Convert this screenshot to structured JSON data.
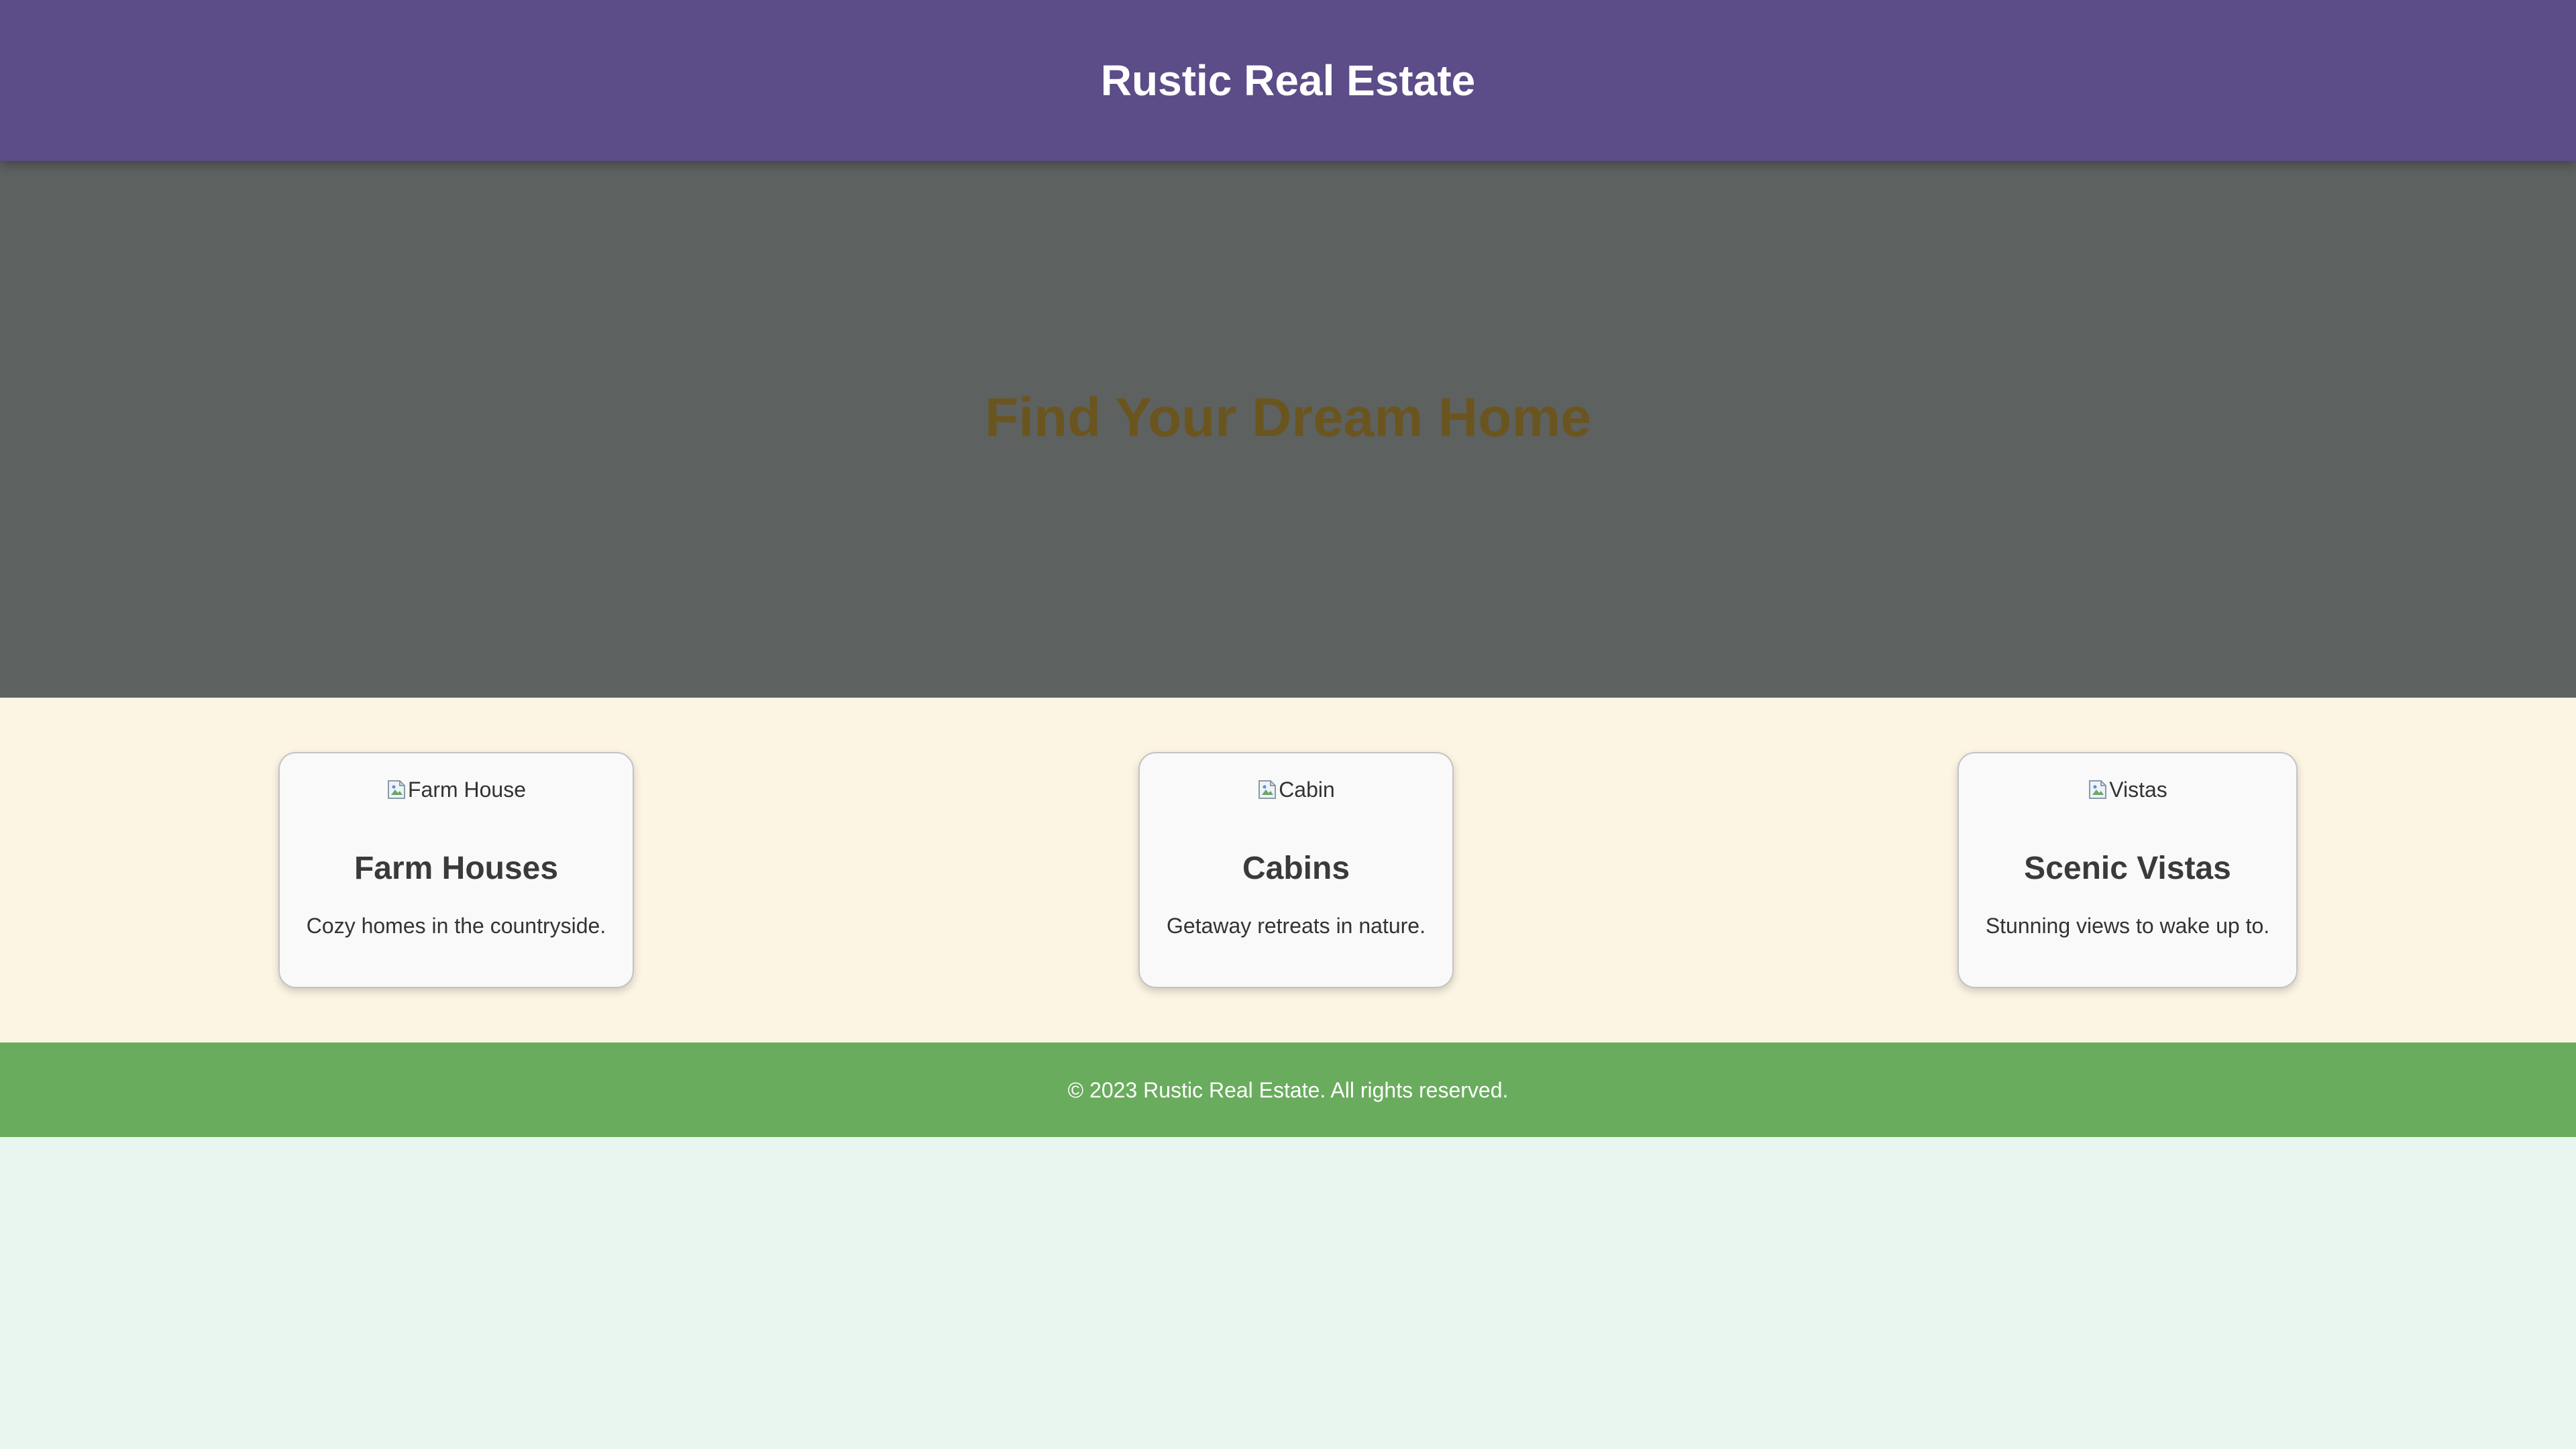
{
  "header": {
    "title": "Rustic Real Estate"
  },
  "hero": {
    "heading": "Find Your Dream Home"
  },
  "listings": [
    {
      "image_alt": "Farm House",
      "title": "Farm Houses",
      "description": "Cozy homes in the countryside."
    },
    {
      "image_alt": "Cabin",
      "title": "Cabins",
      "description": "Getaway retreats in nature."
    },
    {
      "image_alt": "Vistas",
      "title": "Scenic Vistas",
      "description": "Stunning views to wake up to."
    }
  ],
  "footer": {
    "text": "© 2023 Rustic Real Estate. All rights reserved."
  },
  "colors": {
    "header_bg": "#5c4c87",
    "hero_bg": "#5d6160",
    "hero_text": "#6b551f",
    "listings_bg": "#fdf5e3",
    "card_bg": "#f9f9f9",
    "footer_bg": "#69ac5d",
    "page_bg": "#e8f6ef"
  },
  "icons": {
    "card_image": "broken-image-icon"
  }
}
